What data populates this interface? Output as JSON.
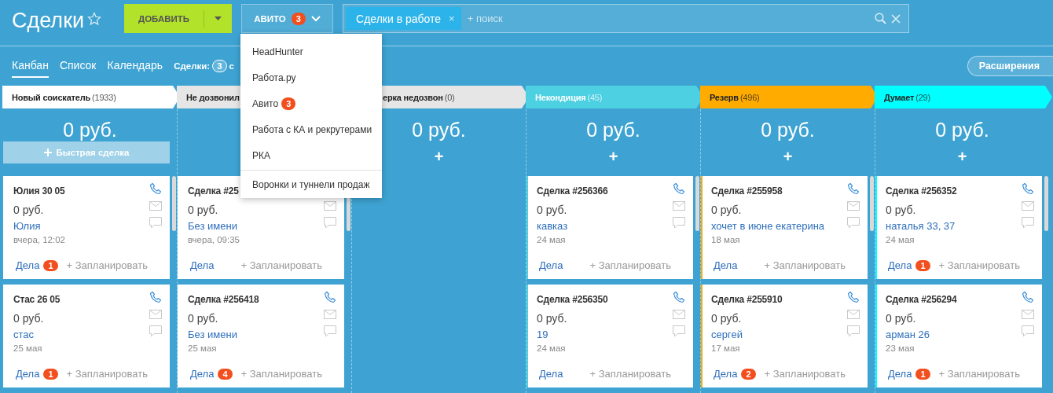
{
  "header": {
    "title": "Сделки",
    "add_button": "ДОБАВИТЬ",
    "pipeline": {
      "label": "АВИТО",
      "badge": "3"
    },
    "filter": {
      "tag": "Сделки в работе",
      "tag_remove": "×",
      "placeholder": "+ поиск"
    }
  },
  "pipeline_menu": {
    "items": [
      {
        "label": "HeadHunter"
      },
      {
        "label": "Работа.ру"
      },
      {
        "label": "Авито",
        "badge": "3"
      },
      {
        "label": "Работа с КА и рекрутерами"
      },
      {
        "label": "РКА"
      },
      {
        "label": "Воронки и туннели продаж",
        "kind": "footer"
      }
    ]
  },
  "view_tabs": [
    {
      "label": "Канбан",
      "selected": true
    },
    {
      "label": "Список",
      "selected": false
    },
    {
      "label": "Календарь",
      "selected": false
    }
  ],
  "deals_summary": {
    "label": "Сделки:",
    "count": "3",
    "suffix": "с"
  },
  "extensions_button": "Расширения",
  "columns": [
    {
      "title": "Новый соискатель",
      "count": "(1933)",
      "color": "#ffffff",
      "amount": "0 руб.",
      "add": {
        "kind": "quick",
        "label": "Быстрая сделка"
      },
      "cards": [
        {
          "title": "Юлия 30 05",
          "price": "0 руб.",
          "contact": "Юлия",
          "date": "вчера, 12:02",
          "tasks": "Дела",
          "task_count": "1",
          "plan": "+ Запланировать"
        },
        {
          "title": "Стас 26 05",
          "price": "0 руб.",
          "contact": "стас",
          "date": "25 мая",
          "tasks": "Дела",
          "task_count": "1",
          "plan": "+ Запланировать"
        }
      ]
    },
    {
      "title": "Не дозвонил",
      "color": "#e6e6e6",
      "cards": [
        {
          "title": "Сделка #25",
          "price": "0 руб.",
          "contact": "Без имени",
          "date": "вчера, 09:35",
          "tasks": "Дела",
          "plan": "+ Запланировать"
        },
        {
          "title": "Сделка #256418",
          "price": "0 руб.",
          "contact": "Без имени",
          "date": "25 мая",
          "tasks": "Дела",
          "task_count": "4",
          "plan": "+ Запланировать"
        }
      ]
    },
    {
      "title": "ерка недозвон",
      "count": "(0)",
      "color": "#e6e6e6",
      "amount": "0 руб.",
      "add": {
        "kind": "plus",
        "label": "+"
      }
    },
    {
      "title": "Некондиция",
      "count": "(45)",
      "color": "#4dd0e1",
      "amount": "0 руб.",
      "add": {
        "kind": "plus",
        "label": "+"
      },
      "cards": [
        {
          "title": "Сделка #256366",
          "price": "0 руб.",
          "contact": "кавказ",
          "date": "24 мая",
          "tasks": "Дела",
          "plan": "+ Запланировать"
        },
        {
          "title": "Сделка #256350",
          "price": "0 руб.",
          "contact": "19",
          "date": "24 мая",
          "tasks": "Дела",
          "plan": "+ Запланировать"
        }
      ]
    },
    {
      "title": "Резерв",
      "count": "(496)",
      "color": "#ffab00",
      "amount": "0 руб.",
      "add": {
        "kind": "plus",
        "label": "+"
      },
      "cards": [
        {
          "title": "Сделка #255958",
          "price": "0 руб.",
          "contact": "хочет в июне екатерина",
          "date": "18 мая",
          "tasks": "Дела",
          "plan": "+ Запланировать"
        },
        {
          "title": "Сделка #255910",
          "price": "0 руб.",
          "contact": "сергей",
          "date": "17 мая",
          "tasks": "Дела",
          "task_count": "2",
          "plan": "+ Запланировать"
        }
      ]
    },
    {
      "title": "Думает",
      "count": "(29)",
      "color": "#00ffff",
      "amount": "0 руб.",
      "add": {
        "kind": "plus",
        "label": "+"
      },
      "cards": [
        {
          "title": "Сделка #256352",
          "price": "0 руб.",
          "contact": "наталья 33, 37",
          "date": "24 мая",
          "tasks": "Дела",
          "task_count": "1",
          "plan": "+ Запланировать"
        },
        {
          "title": "Сделка #256294",
          "price": "0 руб.",
          "contact": "арман 26",
          "date": "23 мая",
          "tasks": "Дела",
          "task_count": "1",
          "plan": "+ Запланировать"
        }
      ]
    }
  ]
}
